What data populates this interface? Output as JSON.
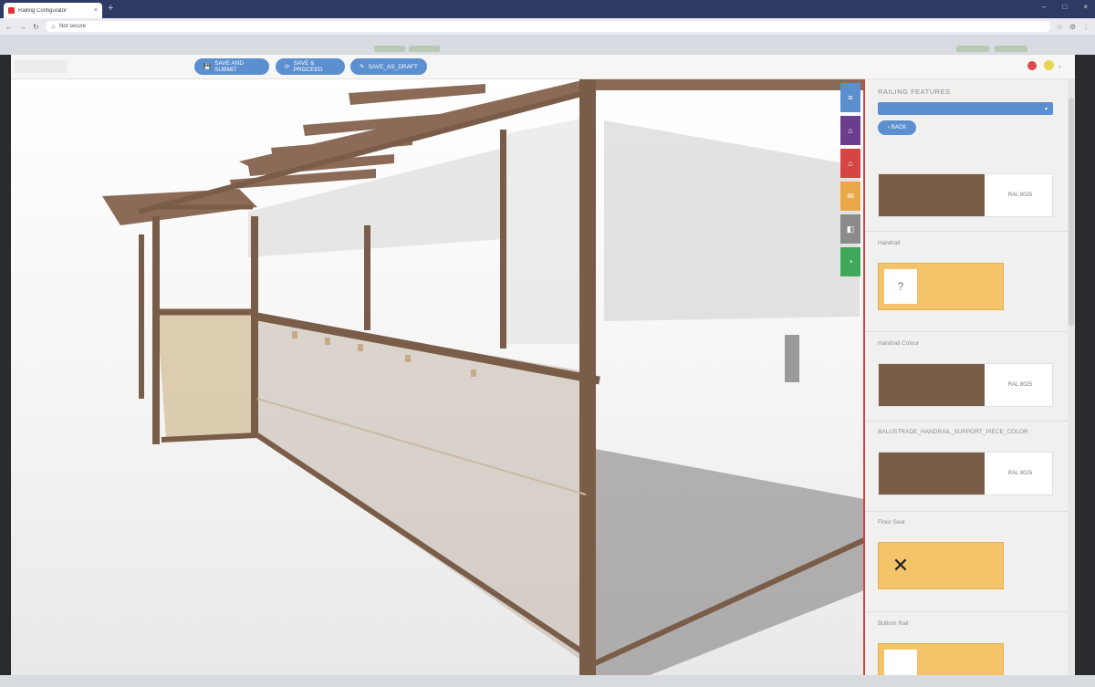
{
  "browser": {
    "tab_title": "Railing Configurator",
    "new_tab_symbol": "+",
    "tab_close_symbol": "×",
    "window_controls": [
      "–",
      "□",
      "×"
    ],
    "nav_symbols": [
      "←",
      "→",
      "↻"
    ],
    "lock_symbol": "⚠",
    "url_security": "Not secure",
    "url": "",
    "extension_symbols": [
      "☆",
      "⚙",
      "⋮"
    ]
  },
  "toolbar": {
    "links": [
      "",
      ""
    ],
    "buttons": [
      {
        "icon": "💾",
        "label": "SAVE AND SUBMIT"
      },
      {
        "icon": "⟳",
        "label": "SAVE & PROCEED"
      },
      {
        "icon": "✎",
        "label": "SAVE_AS_DRAFT"
      }
    ],
    "user_label_1": "",
    "user_label_2": "",
    "user_menu_symbol": "⌄"
  },
  "side_tabs": [
    {
      "icon": "≡",
      "color": "#5b8fd0"
    },
    {
      "icon": "⌂",
      "color": "#6a3d8f"
    },
    {
      "icon": "⌂",
      "color": "#d64545"
    },
    {
      "icon": "✉",
      "color": "#e9a847"
    },
    {
      "icon": "◧",
      "color": "#8b8b8b"
    },
    {
      "icon": "◔",
      "color": "#3fa85a"
    }
  ],
  "panel": {
    "title": "RAILING FEATURES",
    "select_value": "",
    "select_caret": "▾",
    "back_label": "BACK",
    "back_icon": "‹",
    "sections": [
      {
        "label": "",
        "type": "color",
        "value": "RAL 8025"
      },
      {
        "label": "Handrail",
        "type": "option",
        "thumb": "?",
        "value": ""
      },
      {
        "label": "Handrail Colour",
        "type": "color",
        "value": "RAL 8025"
      },
      {
        "label": "BALUSTRADE_HANDRAIL_SUPPORT_PIECE_COLOR",
        "type": "color",
        "value": "RAL 8025"
      },
      {
        "label": "Floor Seal",
        "type": "option",
        "thumb": "✕",
        "value": ""
      },
      {
        "label": "Bottom Rail",
        "type": "option",
        "thumb": "",
        "value": ""
      }
    ]
  },
  "colors": {
    "accent": "#5b8fd0",
    "frame_brown": "#7a5d48",
    "panel_border": "#d64545",
    "option_card": "#f3c46a"
  }
}
